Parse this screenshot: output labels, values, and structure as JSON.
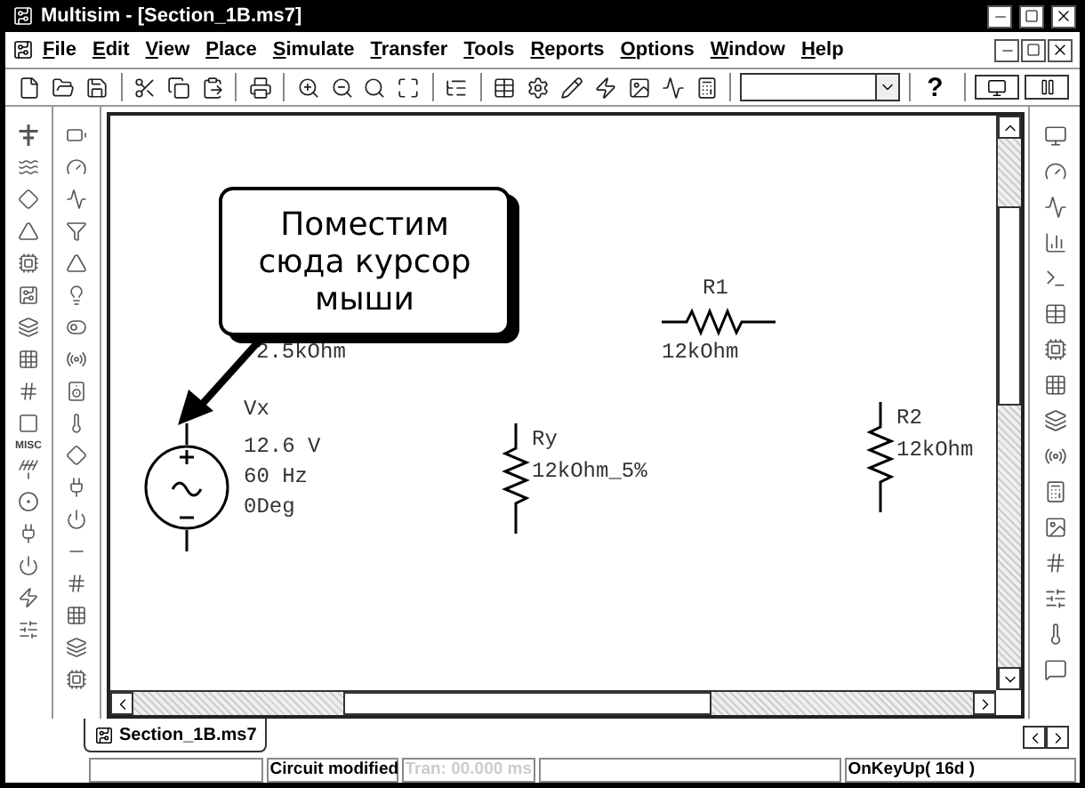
{
  "window": {
    "title": "Multisim - [Section_1B.ms7]"
  },
  "menu": [
    "File",
    "Edit",
    "View",
    "Place",
    "Simulate",
    "Transfer",
    "Tools",
    "Reports",
    "Options",
    "Window",
    "Help"
  ],
  "toolbar": {
    "help": "?"
  },
  "palette": {
    "label": "MISC"
  },
  "callout": {
    "text": "Поместим\nсюда курсор\nмыши"
  },
  "schematic": {
    "stray_labels": [
      "2.5kOhm"
    ],
    "components": [
      {
        "kind": "ac_source",
        "name": "Vx",
        "values": [
          "12.6 V",
          "60 Hz",
          "0Deg"
        ]
      },
      {
        "kind": "resistor_h",
        "name": "R1",
        "value": "12kOhm"
      },
      {
        "kind": "resistor_v",
        "name": "Ry",
        "value": "12kOhm_5%"
      },
      {
        "kind": "resistor_v",
        "name": "R2",
        "value": "12kOhm"
      }
    ]
  },
  "document_tabs": [
    {
      "label": "Section_1B.ms7",
      "selected": true
    }
  ],
  "status_bar": [
    {
      "kind": "empty"
    },
    {
      "kind": "text",
      "text": "Circuit modified",
      "disabled": false
    },
    {
      "kind": "text",
      "text": "Tran: 00.000 ms",
      "disabled": true
    },
    {
      "kind": "empty"
    },
    {
      "kind": "text",
      "text": "OnKeyUp( 16d )",
      "disabled": false
    }
  ]
}
